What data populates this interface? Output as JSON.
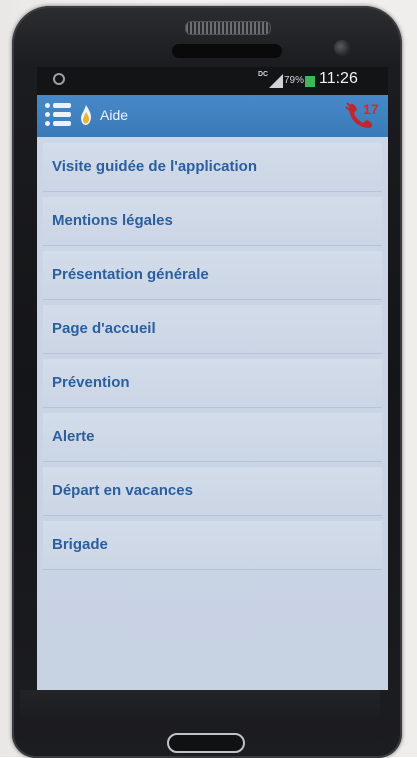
{
  "statusbar": {
    "network_label": "DC",
    "battery_percent": "79%",
    "battery_level": 0.79,
    "time": "11:26",
    "sync_icon": "sync-icon",
    "signal_icon": "signal-icon"
  },
  "appbar": {
    "title": "Aide",
    "menu_icon": "menu-icon",
    "app_icon": "flame-icon",
    "call_number": "17",
    "call_icon": "phone-call-icon",
    "color": "#4789c8"
  },
  "help_menu": {
    "items": [
      {
        "label": "Visite guidée de l'application"
      },
      {
        "label": "Mentions légales"
      },
      {
        "label": "Présentation générale"
      },
      {
        "label": "Page d'accueil"
      },
      {
        "label": "Prévention"
      },
      {
        "label": "Alerte"
      },
      {
        "label": "Départ en vacances"
      },
      {
        "label": "Brigade"
      }
    ],
    "text_color": "#2b5f9e",
    "item_background": "#cfd8e7"
  }
}
